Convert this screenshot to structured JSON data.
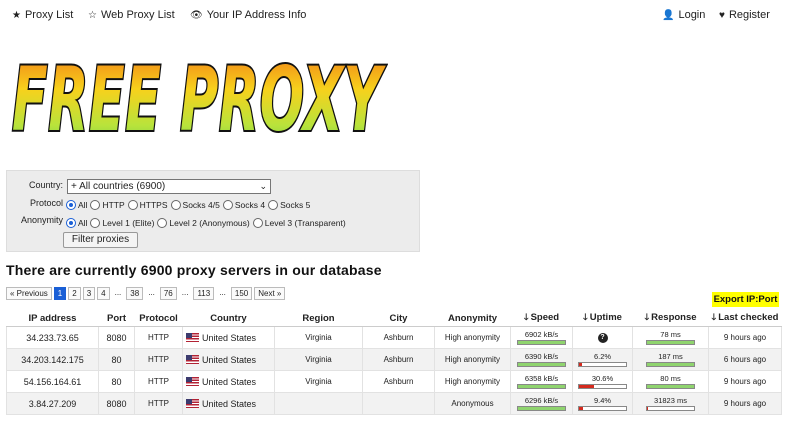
{
  "nav": {
    "proxy_list": "Proxy List",
    "web_proxy_list": "Web Proxy List",
    "ip_info": "Your IP Address Info",
    "login": "Login",
    "register": "Register"
  },
  "logo": {
    "text": "FREE PROXY"
  },
  "filter": {
    "country_label": "Country:",
    "country_value": "+ All countries (6900)",
    "protocol_label": "Protocol",
    "protocols": [
      "All",
      "HTTP",
      "HTTPS",
      "Socks 4/5",
      "Socks 4",
      "Socks 5"
    ],
    "anonymity_label": "Anonymity",
    "anonymities": [
      "All",
      "Level 1 (Elite)",
      "Level 2 (Anonymous)",
      "Level 3 (Transparent)"
    ],
    "button": "Filter proxies"
  },
  "heading": "There are currently 6900 proxy servers in our database",
  "pagination": [
    "« Previous",
    "1",
    "2",
    "3",
    "4",
    "...",
    "38",
    "...",
    "76",
    "...",
    "113",
    "...",
    "150",
    "Next »"
  ],
  "export_label": "Export IP:Port",
  "table": {
    "headers": [
      "IP address",
      "Port",
      "Protocol",
      "Country",
      "Region",
      "City",
      "Anonymity",
      "Speed",
      "Uptime",
      "Response",
      "Last checked"
    ],
    "rows": [
      {
        "ip": "34.233.73.65",
        "port": "8080",
        "protocol": "HTTP",
        "country": "United States",
        "region": "Virginia",
        "city": "Ashburn",
        "anonymity": "High anonymity",
        "speed": "6902 kB/s",
        "speed_pct": 1.0,
        "uptime": "",
        "uptime_pct": null,
        "response": "78 ms",
        "response_pct": 1.0,
        "last_checked": "9 hours ago"
      },
      {
        "ip": "34.203.142.175",
        "port": "80",
        "protocol": "HTTP",
        "country": "United States",
        "region": "Virginia",
        "city": "Ashburn",
        "anonymity": "High anonymity",
        "speed": "6390 kB/s",
        "speed_pct": 1.0,
        "uptime": "6.2%",
        "uptime_pct": 0.06,
        "response": "187 ms",
        "response_pct": 1.0,
        "last_checked": "6 hours ago"
      },
      {
        "ip": "54.156.164.61",
        "port": "80",
        "protocol": "HTTP",
        "country": "United States",
        "region": "Virginia",
        "city": "Ashburn",
        "anonymity": "High anonymity",
        "speed": "6358 kB/s",
        "speed_pct": 1.0,
        "uptime": "30.6%",
        "uptime_pct": 0.31,
        "response": "80 ms",
        "response_pct": 1.0,
        "last_checked": "9 hours ago"
      },
      {
        "ip": "3.84.27.209",
        "port": "8080",
        "protocol": "HTTP",
        "country": "United States",
        "region": "",
        "city": "",
        "anonymity": "Anonymous",
        "speed": "6296 kB/s",
        "speed_pct": 1.0,
        "uptime": "9.4%",
        "uptime_pct": 0.09,
        "response": "31823 ms",
        "response_pct": 0.03,
        "last_checked": "9 hours ago"
      }
    ]
  },
  "colors": {
    "accent": "#1a5fd6",
    "good": "#8fd46e",
    "bad": "#d42a1e",
    "export_bg": "#ffff00"
  }
}
